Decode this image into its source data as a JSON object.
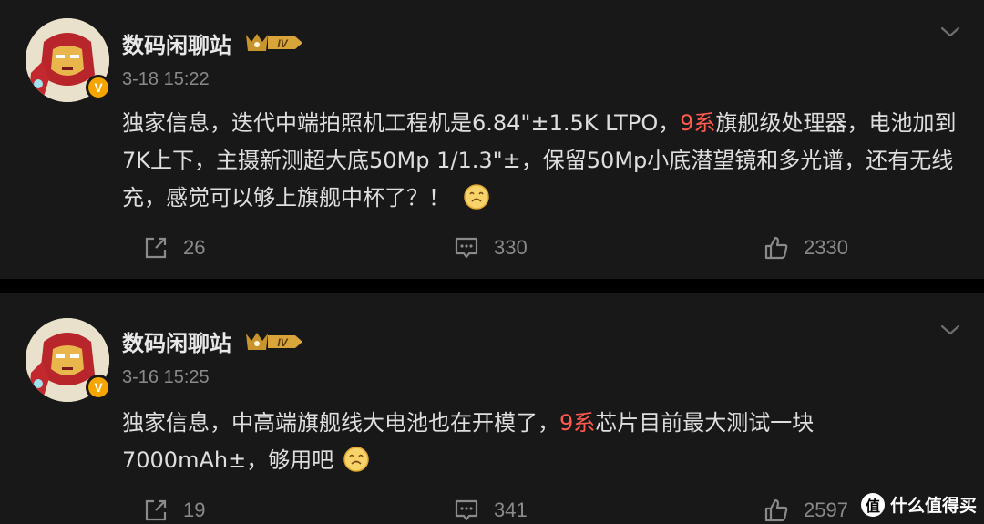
{
  "posts": [
    {
      "author": "数码闲聊站",
      "level_badge": "IV",
      "verified_badge": "V",
      "time": "3-18 15:22",
      "content_before": "独家信息，迭代中端拍照机工程机是6.84\"±1.5K LTPO，",
      "content_highlight": "9系",
      "content_after": "旗舰级处理器，电池加到7K上下，主摄新测超大底50Mp 1/1.3\"±，保留50Mp小底潜望镜和多光谱，还有无线充，感觉可以够上旗舰中杯了？！",
      "emoji": "face-emoji",
      "reposts": "26",
      "comments": "330",
      "likes": "2330"
    },
    {
      "author": "数码闲聊站",
      "level_badge": "IV",
      "verified_badge": "V",
      "time": "3-16 15:25",
      "content_before": "独家信息，中高端旗舰线大电池也在开模了，",
      "content_highlight": "9系",
      "content_after": "芯片目前最大测试一块7000mAh±，够用吧",
      "emoji": "face-emoji",
      "reposts": "19",
      "comments": "341",
      "likes": "2597"
    }
  ],
  "colors": {
    "background": "#000000",
    "card": "#181818",
    "highlight": "#ff5a4d",
    "muted": "#8a8a8a",
    "badge_gold": "#f5a400"
  },
  "watermark": {
    "logo": "值",
    "text": "什么值得买"
  }
}
